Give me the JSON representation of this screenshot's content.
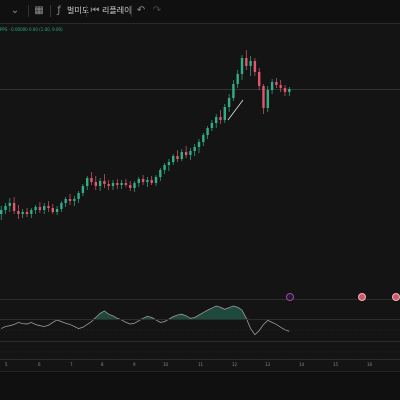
{
  "toolbar": {
    "indicator_label": "벌미도",
    "replay_label": "리플레이",
    "icons": [
      "chevron-icon",
      "layout-icon",
      "indicator-icon",
      "replay-icon",
      "undo-icon",
      "redo-icon"
    ]
  },
  "legend": {
    "text": "PPS · 0.00000 0.00 (1.00, 9.00)"
  },
  "price_pane": {
    "candles": [
      {
        "o": 214,
        "h": 206,
        "l": 220,
        "c": 210,
        "dir": "up"
      },
      {
        "o": 210,
        "h": 203,
        "l": 214,
        "c": 206,
        "dir": "up"
      },
      {
        "o": 206,
        "h": 198,
        "l": 212,
        "c": 203,
        "dir": "up"
      },
      {
        "o": 203,
        "h": 197,
        "l": 214,
        "c": 211,
        "dir": "down"
      },
      {
        "o": 211,
        "h": 205,
        "l": 219,
        "c": 214,
        "dir": "down"
      },
      {
        "o": 214,
        "h": 209,
        "l": 218,
        "c": 212,
        "dir": "up"
      },
      {
        "o": 212,
        "h": 208,
        "l": 217,
        "c": 214,
        "dir": "down"
      },
      {
        "o": 214,
        "h": 208,
        "l": 218,
        "c": 210,
        "dir": "up"
      },
      {
        "o": 210,
        "h": 205,
        "l": 214,
        "c": 207,
        "dir": "up"
      },
      {
        "o": 207,
        "h": 202,
        "l": 213,
        "c": 210,
        "dir": "down"
      },
      {
        "o": 210,
        "h": 203,
        "l": 214,
        "c": 206,
        "dir": "up"
      },
      {
        "o": 206,
        "h": 201,
        "l": 212,
        "c": 208,
        "dir": "down"
      },
      {
        "o": 208,
        "h": 204,
        "l": 214,
        "c": 212,
        "dir": "down"
      },
      {
        "o": 212,
        "h": 206,
        "l": 215,
        "c": 209,
        "dir": "up"
      },
      {
        "o": 209,
        "h": 201,
        "l": 212,
        "c": 203,
        "dir": "up"
      },
      {
        "o": 203,
        "h": 197,
        "l": 207,
        "c": 199,
        "dir": "up"
      },
      {
        "o": 199,
        "h": 194,
        "l": 205,
        "c": 201,
        "dir": "down"
      },
      {
        "o": 201,
        "h": 196,
        "l": 206,
        "c": 199,
        "dir": "up"
      },
      {
        "o": 199,
        "h": 191,
        "l": 203,
        "c": 193,
        "dir": "up"
      },
      {
        "o": 193,
        "h": 184,
        "l": 196,
        "c": 186,
        "dir": "up"
      },
      {
        "o": 186,
        "h": 176,
        "l": 190,
        "c": 178,
        "dir": "up"
      },
      {
        "o": 178,
        "h": 172,
        "l": 185,
        "c": 182,
        "dir": "down"
      },
      {
        "o": 182,
        "h": 176,
        "l": 190,
        "c": 186,
        "dir": "down"
      },
      {
        "o": 186,
        "h": 178,
        "l": 191,
        "c": 181,
        "dir": "up"
      },
      {
        "o": 181,
        "h": 174,
        "l": 188,
        "c": 184,
        "dir": "down"
      },
      {
        "o": 184,
        "h": 180,
        "l": 190,
        "c": 186,
        "dir": "down"
      },
      {
        "o": 186,
        "h": 180,
        "l": 190,
        "c": 183,
        "dir": "up"
      },
      {
        "o": 183,
        "h": 179,
        "l": 189,
        "c": 185,
        "dir": "down"
      },
      {
        "o": 185,
        "h": 180,
        "l": 189,
        "c": 183,
        "dir": "up"
      },
      {
        "o": 183,
        "h": 179,
        "l": 187,
        "c": 185,
        "dir": "down"
      },
      {
        "o": 185,
        "h": 181,
        "l": 191,
        "c": 188,
        "dir": "down"
      },
      {
        "o": 188,
        "h": 181,
        "l": 192,
        "c": 183,
        "dir": "up"
      },
      {
        "o": 183,
        "h": 177,
        "l": 187,
        "c": 179,
        "dir": "up"
      },
      {
        "o": 179,
        "h": 175,
        "l": 185,
        "c": 182,
        "dir": "down"
      },
      {
        "o": 182,
        "h": 177,
        "l": 187,
        "c": 180,
        "dir": "up"
      },
      {
        "o": 180,
        "h": 176,
        "l": 185,
        "c": 183,
        "dir": "down"
      },
      {
        "o": 183,
        "h": 175,
        "l": 186,
        "c": 177,
        "dir": "up"
      },
      {
        "o": 177,
        "h": 168,
        "l": 181,
        "c": 170,
        "dir": "up"
      },
      {
        "o": 170,
        "h": 163,
        "l": 174,
        "c": 165,
        "dir": "up"
      },
      {
        "o": 165,
        "h": 159,
        "l": 171,
        "c": 162,
        "dir": "up"
      },
      {
        "o": 162,
        "h": 154,
        "l": 165,
        "c": 156,
        "dir": "up"
      },
      {
        "o": 156,
        "h": 150,
        "l": 162,
        "c": 159,
        "dir": "down"
      },
      {
        "o": 159,
        "h": 149,
        "l": 161,
        "c": 152,
        "dir": "up"
      },
      {
        "o": 152,
        "h": 146,
        "l": 158,
        "c": 155,
        "dir": "down"
      },
      {
        "o": 155,
        "h": 148,
        "l": 160,
        "c": 151,
        "dir": "up"
      },
      {
        "o": 151,
        "h": 144,
        "l": 156,
        "c": 147,
        "dir": "up"
      },
      {
        "o": 147,
        "h": 139,
        "l": 153,
        "c": 142,
        "dir": "up"
      },
      {
        "o": 142,
        "h": 133,
        "l": 146,
        "c": 135,
        "dir": "up"
      },
      {
        "o": 135,
        "h": 126,
        "l": 139,
        "c": 128,
        "dir": "up"
      },
      {
        "o": 128,
        "h": 120,
        "l": 131,
        "c": 123,
        "dir": "up"
      },
      {
        "o": 123,
        "h": 114,
        "l": 128,
        "c": 117,
        "dir": "up"
      },
      {
        "o": 117,
        "h": 110,
        "l": 124,
        "c": 120,
        "dir": "down"
      },
      {
        "o": 120,
        "h": 104,
        "l": 123,
        "c": 107,
        "dir": "up"
      },
      {
        "o": 107,
        "h": 94,
        "l": 112,
        "c": 98,
        "dir": "up"
      },
      {
        "o": 98,
        "h": 80,
        "l": 101,
        "c": 84,
        "dir": "up"
      },
      {
        "o": 84,
        "h": 70,
        "l": 88,
        "c": 74,
        "dir": "up"
      },
      {
        "o": 74,
        "h": 55,
        "l": 80,
        "c": 58,
        "dir": "up"
      },
      {
        "o": 58,
        "h": 50,
        "l": 70,
        "c": 66,
        "dir": "down"
      },
      {
        "o": 66,
        "h": 56,
        "l": 76,
        "c": 61,
        "dir": "up"
      },
      {
        "o": 61,
        "h": 58,
        "l": 76,
        "c": 72,
        "dir": "down"
      },
      {
        "o": 72,
        "h": 68,
        "l": 90,
        "c": 86,
        "dir": "down"
      },
      {
        "o": 86,
        "h": 84,
        "l": 114,
        "c": 108,
        "dir": "down"
      },
      {
        "o": 108,
        "h": 86,
        "l": 112,
        "c": 90,
        "dir": "up"
      },
      {
        "o": 90,
        "h": 79,
        "l": 94,
        "c": 82,
        "dir": "up"
      },
      {
        "o": 82,
        "h": 78,
        "l": 88,
        "c": 85,
        "dir": "down"
      },
      {
        "o": 85,
        "h": 80,
        "l": 92,
        "c": 88,
        "dir": "down"
      },
      {
        "o": 88,
        "h": 85,
        "l": 96,
        "c": 92,
        "dir": "down"
      },
      {
        "o": 92,
        "h": 87,
        "l": 96,
        "c": 89,
        "dir": "up"
      }
    ]
  },
  "oscillator": {
    "values": [
      0.45,
      0.5,
      0.52,
      0.55,
      0.6,
      0.57,
      0.56,
      0.6,
      0.55,
      0.52,
      0.5,
      0.53,
      0.6,
      0.66,
      0.62,
      0.58,
      0.55,
      0.5,
      0.45,
      0.48,
      0.55,
      0.62,
      0.72,
      0.82,
      0.88,
      0.8,
      0.76,
      0.7,
      0.66,
      0.6,
      0.56,
      0.58,
      0.64,
      0.7,
      0.75,
      0.72,
      0.66,
      0.6,
      0.62,
      0.68,
      0.74,
      0.78,
      0.8,
      0.76,
      0.7,
      0.72,
      0.78,
      0.84,
      0.9,
      0.95,
      1.0,
      0.97,
      0.92,
      0.96,
      1.0,
      0.97,
      0.9,
      0.7,
      0.45,
      0.3,
      0.4,
      0.55,
      0.65,
      0.6,
      0.55,
      0.48,
      0.42,
      0.38
    ]
  },
  "time_axis": {
    "labels": [
      "5",
      "6",
      "7",
      "8",
      "9",
      "10",
      "11",
      "12",
      "13",
      "14",
      "15",
      "16"
    ]
  },
  "colors": {
    "up": "#2fae87",
    "down": "#e0566a",
    "trendline": "#e8e8e8",
    "osc_line": "#9b9b9b",
    "event": "#a04aa8",
    "event_red": "#d05865"
  }
}
